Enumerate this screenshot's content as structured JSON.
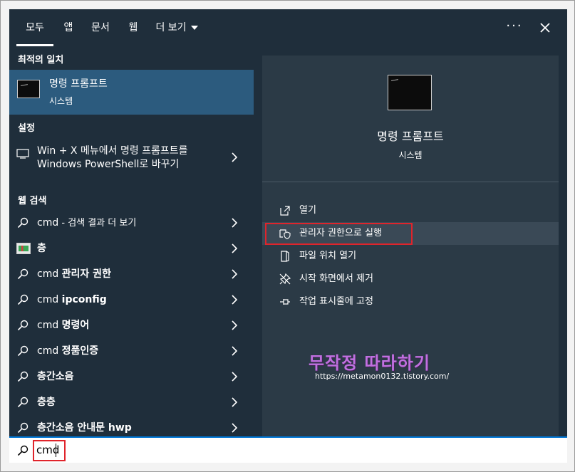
{
  "tabs": [
    {
      "label": "모두",
      "active": true
    },
    {
      "label": "앱"
    },
    {
      "label": "문서"
    },
    {
      "label": "웹"
    },
    {
      "label": "더 보기"
    }
  ],
  "more_label": "···",
  "sections": {
    "best_match": "최적의 일치",
    "settings": "설정",
    "web_search": "웹 검색"
  },
  "best_match": {
    "title": "명령 프롬프트",
    "subtitle": "시스템"
  },
  "settings_item": {
    "line1": "Win + X 메뉴에서 명령 프롬프트를",
    "line2": "Windows PowerShell로 바꾸기"
  },
  "web_results": [
    {
      "prefix": "cmd",
      "rest": " - 검색 결과 더 보기",
      "icon": "search-icon"
    },
    {
      "prefix": "",
      "rest": "층",
      "icon": "image-thumb"
    },
    {
      "prefix": "cmd ",
      "rest": "관리자 권한",
      "icon": "search-icon"
    },
    {
      "prefix": "cmd ",
      "rest": "ipconfig",
      "icon": "search-icon"
    },
    {
      "prefix": "cmd ",
      "rest": "명령어",
      "icon": "search-icon"
    },
    {
      "prefix": "cmd ",
      "rest": "정품인증",
      "icon": "search-icon"
    },
    {
      "prefix": "",
      "rest": "층간소음",
      "icon": "search-icon"
    },
    {
      "prefix": "",
      "rest": "층층",
      "icon": "search-icon"
    },
    {
      "prefix": "",
      "rest": "층간소음 안내문 hwp",
      "icon": "search-icon"
    }
  ],
  "preview": {
    "title": "명령 프롬프트",
    "subtitle": "시스템"
  },
  "actions": [
    {
      "label": "열기",
      "icon": "open-icon"
    },
    {
      "label": "관리자 권한으로 실행",
      "icon": "shield-icon"
    },
    {
      "label": "파일 위치 열기",
      "icon": "file-location-icon"
    },
    {
      "label": "시작 화면에서 제거",
      "icon": "unpin-icon"
    },
    {
      "label": "작업 표시줄에 고정",
      "icon": "pin-icon"
    }
  ],
  "watermark": {
    "title": "무작정 따라하기",
    "url": "https://metamon0132.tistory.com/"
  },
  "search": {
    "value": "cmd"
  },
  "colors": {
    "panel": "#1f2e3b",
    "selected": "#2c5b7e",
    "right_pane": "#2b3a46",
    "highlight_box": "#e0242b",
    "accent": "#0078d7"
  }
}
